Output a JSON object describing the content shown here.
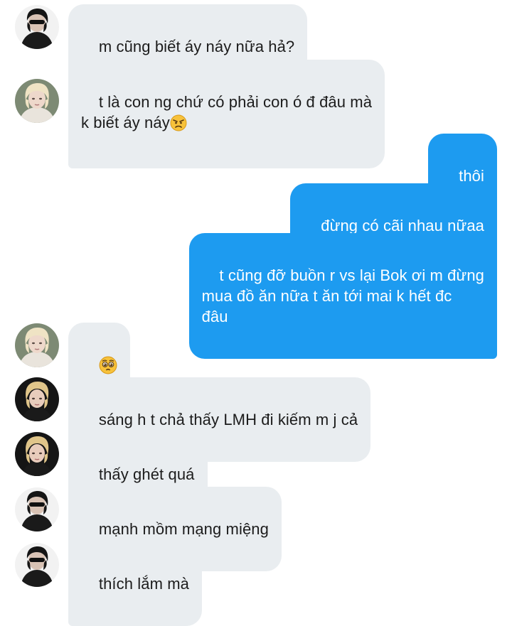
{
  "messages": [
    {
      "from": "them",
      "avatar": "sunglasses-user",
      "text": "m cũng biết áy náy nữa hả?"
    },
    {
      "from": "them",
      "avatar": "blonde-user",
      "text": "t là con ng chứ có phải con ó đ đâu mà\nk biết áy náy",
      "emoji": "angry-face"
    },
    {
      "from": "me",
      "text": "thôi"
    },
    {
      "from": "me",
      "text": "đừng có cãi nhau nữaa"
    },
    {
      "from": "me",
      "text": "t cũng đỡ buồn r vs lại Bok ơi m đừng\nmua đồ ăn nữa t ăn tới mai k hết đc\nđâu"
    },
    {
      "from": "them",
      "avatar": "blonde-user",
      "text": "",
      "emoji": "pleading-face"
    },
    {
      "from": "them",
      "avatar": "blonde-black-user",
      "text": "sáng h t chả thấy LMH đi kiếm m j cả"
    },
    {
      "from": "them",
      "avatar": "blonde-black-user",
      "text": "thấy ghét quá"
    },
    {
      "from": "them",
      "avatar": "sunglasses-user",
      "text": "mạnh mồm mạng miệng"
    },
    {
      "from": "them",
      "avatar": "sunglasses-user",
      "text": "thích lắm mà"
    }
  ],
  "colors": {
    "incoming_bubble": "#e9edf0",
    "outgoing_bubble": "#1d9bf0",
    "incoming_text": "#1c1c1c",
    "outgoing_text": "#ffffff"
  }
}
